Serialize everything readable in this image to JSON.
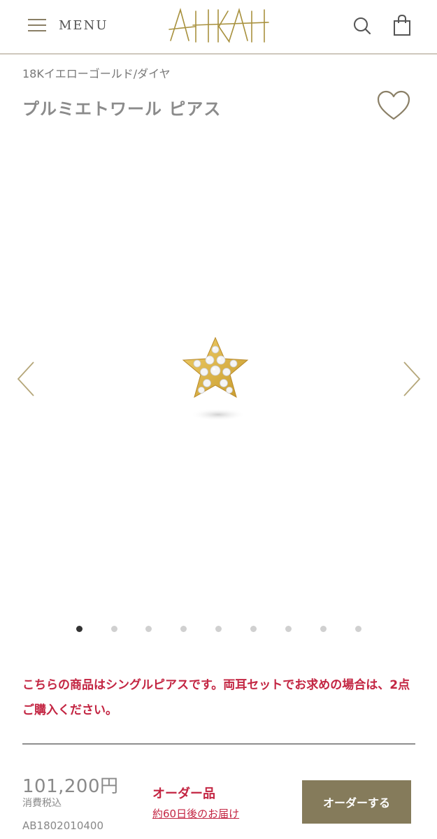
{
  "header": {
    "menu_label": "MENU",
    "logo_text": "AHKAH",
    "brand_color": "#a8913e"
  },
  "product": {
    "material": "18Kイエローゴールド/ダイヤ",
    "name": "プルミエトワール ピアス",
    "gallery": {
      "total_images": 9,
      "active_index": 0
    },
    "notice": "こちらの商品はシングルピアスです。両耳セットでお求めの場合は、2点ご購入ください。",
    "price": "101,200円",
    "tax_note": "消費税込",
    "sku": "AB1802010400",
    "order_type": "オーダー品",
    "delivery": "約60日後のお届け",
    "order_button": "オーダーする"
  },
  "icons": {
    "menu": "hamburger-icon",
    "search": "search-icon",
    "bag": "shopping-bag-icon",
    "favorite": "heart-icon",
    "prev": "chevron-left-icon",
    "next": "chevron-right-icon"
  },
  "colors": {
    "accent_red": "#c32542",
    "button_bg": "#857b5b",
    "gold": "#d4a93c"
  }
}
